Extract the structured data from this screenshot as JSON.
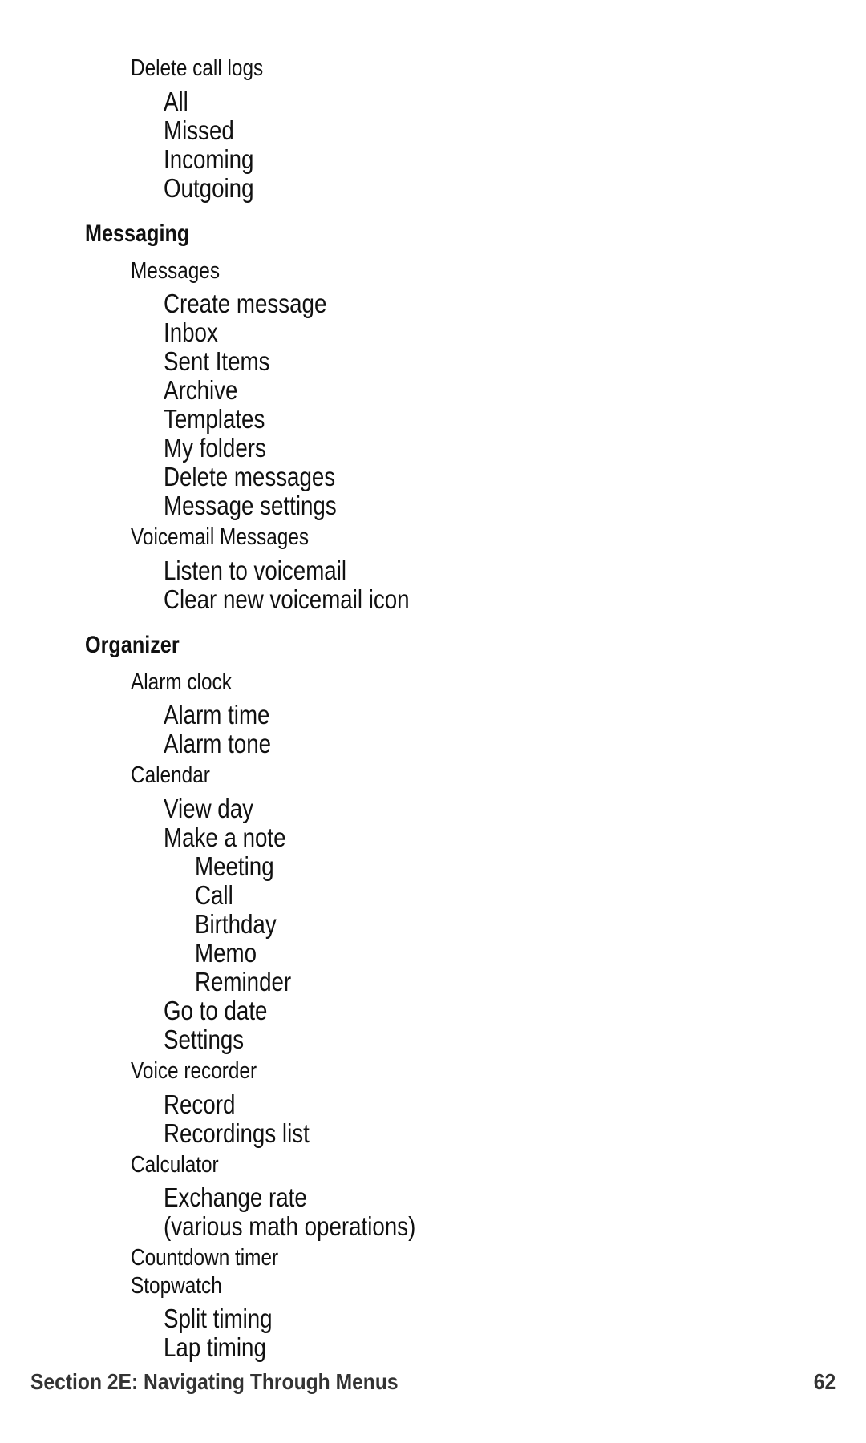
{
  "page": {
    "number": "62",
    "background_color": "#ffffff",
    "text_color": "#111111",
    "footer_text_color": "#333333"
  },
  "footer": {
    "section_title": "Section 2E: Navigating Through Menus",
    "page_number": "62"
  },
  "outline": {
    "rows": [
      {
        "level": "lvl-1",
        "text": "Delete call logs"
      },
      {
        "level": "lvl-2",
        "text": "All"
      },
      {
        "level": "lvl-2",
        "text": "Missed"
      },
      {
        "level": "lvl-2",
        "text": "Incoming"
      },
      {
        "level": "lvl-2",
        "text": "Outgoing"
      },
      {
        "level": "lvl-head",
        "text": "Messaging"
      },
      {
        "level": "lvl-1",
        "text": "Messages"
      },
      {
        "level": "lvl-2",
        "text": "Create message"
      },
      {
        "level": "lvl-2",
        "text": "Inbox"
      },
      {
        "level": "lvl-2",
        "text": "Sent Items"
      },
      {
        "level": "lvl-2",
        "text": "Archive"
      },
      {
        "level": "lvl-2",
        "text": "Templates"
      },
      {
        "level": "lvl-2",
        "text": "My folders"
      },
      {
        "level": "lvl-2",
        "text": "Delete messages"
      },
      {
        "level": "lvl-2",
        "text": "Message settings"
      },
      {
        "level": "lvl-1",
        "text": "Voicemail Messages"
      },
      {
        "level": "lvl-2",
        "text": "Listen to voicemail"
      },
      {
        "level": "lvl-2",
        "text": "Clear new voicemail icon"
      },
      {
        "level": "lvl-head",
        "text": "Organizer"
      },
      {
        "level": "lvl-1",
        "text": "Alarm clock"
      },
      {
        "level": "lvl-2",
        "text": "Alarm time"
      },
      {
        "level": "lvl-2",
        "text": "Alarm tone"
      },
      {
        "level": "lvl-1",
        "text": "Calendar"
      },
      {
        "level": "lvl-2",
        "text": "View day"
      },
      {
        "level": "lvl-2",
        "text": "Make a note"
      },
      {
        "level": "lvl-3",
        "text": "Meeting"
      },
      {
        "level": "lvl-3",
        "text": "Call"
      },
      {
        "level": "lvl-3",
        "text": "Birthday"
      },
      {
        "level": "lvl-3",
        "text": "Memo"
      },
      {
        "level": "lvl-3",
        "text": "Reminder"
      },
      {
        "level": "lvl-2",
        "text": "Go to date"
      },
      {
        "level": "lvl-2",
        "text": "Settings"
      },
      {
        "level": "lvl-1",
        "text": "Voice recorder"
      },
      {
        "level": "lvl-2",
        "text": "Record"
      },
      {
        "level": "lvl-2",
        "text": "Recordings list"
      },
      {
        "level": "lvl-1",
        "text": "Calculator"
      },
      {
        "level": "lvl-2",
        "text": "Exchange rate"
      },
      {
        "level": "lvl-2",
        "text": "(various math operations)"
      },
      {
        "level": "lvl-1",
        "text": "Countdown timer"
      },
      {
        "level": "lvl-1",
        "text": "Stopwatch"
      },
      {
        "level": "lvl-2",
        "text": "Split timing"
      },
      {
        "level": "lvl-2",
        "text": "Lap timing"
      }
    ]
  }
}
